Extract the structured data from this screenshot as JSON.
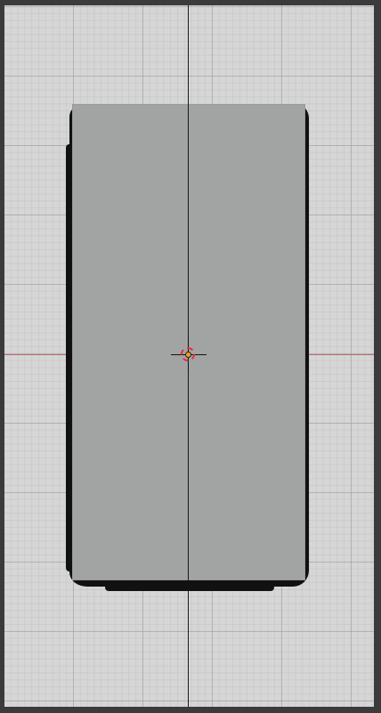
{
  "app": {
    "type": "3D viewport"
  },
  "viewport": {
    "view": "orthographic"
  },
  "scene": {
    "objects": [
      {
        "name": "",
        "shape": "plane"
      },
      {
        "name": "",
        "shape": "rounded-outline"
      }
    ],
    "axes": {
      "x_color": "#c06a72",
      "y_color": "#8ca06a"
    },
    "cursor": {
      "icon": "3d-cursor-icon",
      "color": "#e32d3d"
    },
    "origin": {
      "icon": "origin-dot-icon",
      "color": "#f0a21d"
    }
  },
  "colors": {
    "background": "#3b3b3b",
    "grid_background": "#d6d6d6",
    "plane": "#a2a3a3",
    "outline": "#111111"
  }
}
